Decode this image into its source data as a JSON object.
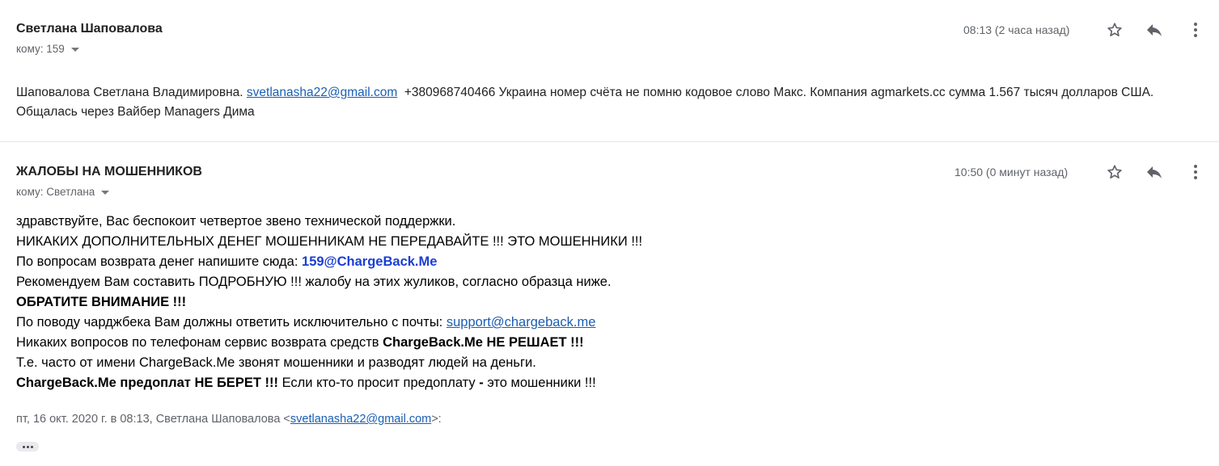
{
  "messages": [
    {
      "sender": "Светлана Шаповалова",
      "to_label": "кому: 159",
      "time": "08:13 (2 часа назад)",
      "body": {
        "part1": "Шаповалова Светлана Владимировна. ",
        "email": "svetlanasha22@gmail.com",
        "part2": "  +380968740466 Украина номер счёта не помню кодовое слово Макс. Компания agmarkets.cc сумма 1.567 тысяч долларов США. Общалась через Вайбер Managers Дима"
      }
    },
    {
      "sender": "ЖАЛОБЫ НА МОШЕННИКОВ",
      "to_label": "кому: Светлана",
      "time": "10:50 (0 минут назад)",
      "body": {
        "l1": "здравствуйте, Вас беспокоит четвертое звено технической поддержки.",
        "l2": "НИКАКИХ ДОПОЛНИТЕЛЬНЫХ ДЕНЕГ МОШЕННИКАМ НЕ ПЕРЕДАВАЙТЕ !!! ЭТО МОШЕННИКИ !!!",
        "l3_text": "По вопросам возврата денег напишите сюда: ",
        "l3_email": "159@ChargeBack.Me",
        "l4": "Рекомендуем Вам составить ПОДРОБНУЮ !!! жалобу на этих жуликов, согласно образца ниже.",
        "l5": "ОБРАТИТЕ ВНИМАНИЕ !!!",
        "l6_text": "По поводу чарджбека Вам должны ответить исключительно с почты: ",
        "l6_email": "support@chargeback.me",
        "l7_text": "Никаких вопросов по телефонам сервис возврата средств ",
        "l7_bold": "ChargeBack.Me НЕ РЕШАЕТ !!!",
        "l8": "Т.е. часто от имени ChargeBack.Me звонят мошенники и разводят людей на деньги.",
        "l9_bold": "ChargeBack.Me предоплат НЕ БЕРЕТ !!!",
        "l9_text": " Если кто-то просит предоплату ",
        "l9_dash": "-",
        "l9_end": " это мошенники !!!"
      },
      "quote": {
        "prefix": "пт, 16 окт. 2020 г. в 08:13, Светлана Шаповалова <",
        "email": "svetlanasha22@gmail.com",
        "suffix": ">:"
      }
    }
  ],
  "icons": {
    "star": "star-icon",
    "reply": "reply-icon",
    "more": "more-vert-icon",
    "expand": "ellipsis-icon"
  }
}
